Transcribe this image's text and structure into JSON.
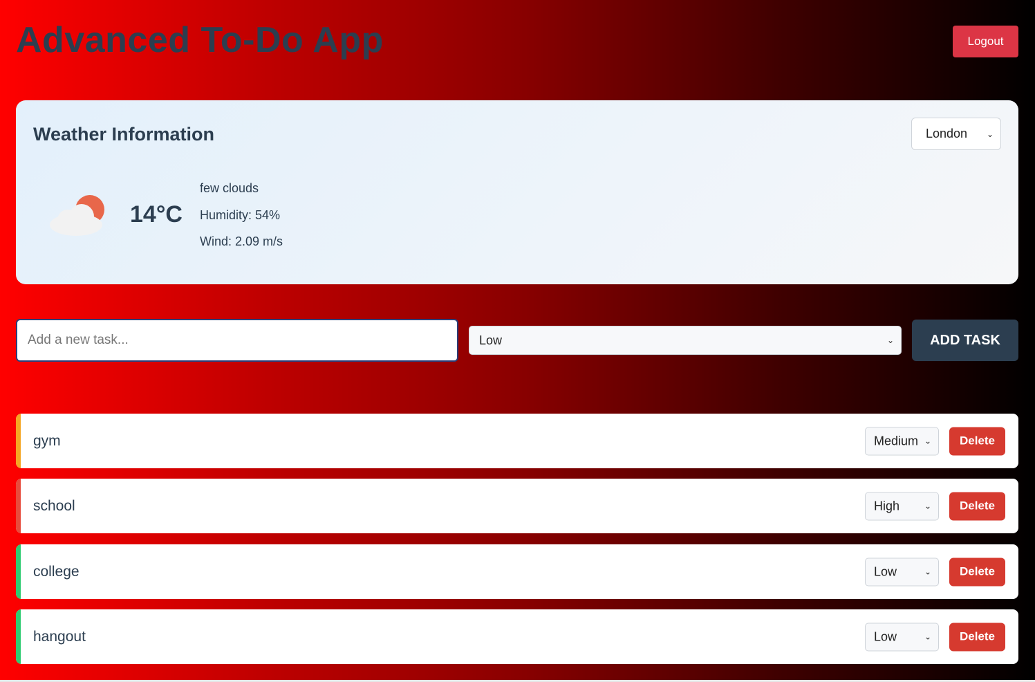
{
  "header": {
    "title": "Advanced To-Do App",
    "logout_label": "Logout"
  },
  "weather": {
    "title": "Weather Information",
    "city": "London",
    "icon": "partly-cloudy-icon",
    "temperature": "14°C",
    "description": "few clouds",
    "humidity": "Humidity: 54%",
    "wind": "Wind: 2.09 m/s"
  },
  "new_task": {
    "placeholder": "Add a new task...",
    "priority": "Low",
    "add_label": "ADD TASK"
  },
  "tasks": [
    {
      "name": "gym",
      "priority": "Medium",
      "delete_label": "Delete",
      "color": "#f5a623"
    },
    {
      "name": "school",
      "priority": "High",
      "delete_label": "Delete",
      "color": "#e74c3c"
    },
    {
      "name": "college",
      "priority": "Low",
      "delete_label": "Delete",
      "color": "#2ecc71"
    },
    {
      "name": "hangout",
      "priority": "Low",
      "delete_label": "Delete",
      "color": "#2ecc71"
    }
  ],
  "colors": {
    "accent_dark": "#2c3e50",
    "logout": "#dc3545",
    "delete": "#d63a2f"
  }
}
